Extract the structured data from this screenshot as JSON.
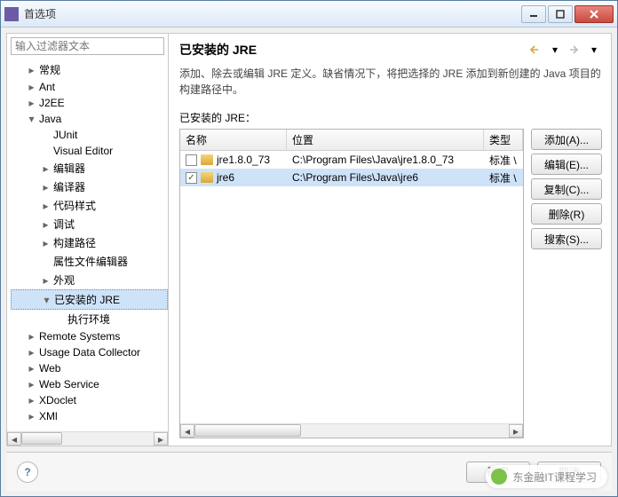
{
  "window": {
    "title": "首选项"
  },
  "filter": {
    "placeholder": "输入过滤器文本"
  },
  "tree": {
    "items": [
      {
        "label": "常规",
        "depth": 1,
        "exp": true
      },
      {
        "label": "Ant",
        "depth": 1,
        "exp": true
      },
      {
        "label": "J2EE",
        "depth": 1,
        "exp": true
      },
      {
        "label": "Java",
        "depth": 1,
        "exp": true,
        "open": true
      },
      {
        "label": "JUnit",
        "depth": 2
      },
      {
        "label": "Visual Editor",
        "depth": 2
      },
      {
        "label": "编辑器",
        "depth": 2,
        "exp": true
      },
      {
        "label": "编译器",
        "depth": 2,
        "exp": true
      },
      {
        "label": "代码样式",
        "depth": 2,
        "exp": true
      },
      {
        "label": "调试",
        "depth": 2,
        "exp": true
      },
      {
        "label": "构建路径",
        "depth": 2,
        "exp": true
      },
      {
        "label": "属性文件编辑器",
        "depth": 2
      },
      {
        "label": "外观",
        "depth": 2,
        "exp": true
      },
      {
        "label": "已安装的 JRE",
        "depth": 2,
        "exp": true,
        "open": true,
        "sel": true
      },
      {
        "label": "执行环境",
        "depth": 3
      },
      {
        "label": "Remote Systems",
        "depth": 1,
        "exp": true
      },
      {
        "label": "Usage Data Collector",
        "depth": 1,
        "exp": true
      },
      {
        "label": "Web",
        "depth": 1,
        "exp": true
      },
      {
        "label": "Web Service",
        "depth": 1,
        "exp": true
      },
      {
        "label": "XDoclet",
        "depth": 1,
        "exp": true
      },
      {
        "label": "XMl",
        "depth": 1,
        "exp": true
      }
    ]
  },
  "page": {
    "title": "已安装的 JRE",
    "desc": "添加、除去或编辑 JRE 定义。缺省情况下，将把选择的 JRE 添加到新创建的 Java 项目的构建路径中。",
    "list_label": "已安装的 JRE：",
    "columns": {
      "name": "名称",
      "location": "位置",
      "type": "类型"
    },
    "rows": [
      {
        "checked": false,
        "name": "jre1.8.0_73",
        "location": "C:\\Program Files\\Java\\jre1.8.0_73",
        "type": "标准 \\"
      },
      {
        "checked": true,
        "name": "jre6",
        "location": "C:\\Program Files\\Java\\jre6",
        "type": "标准 \\",
        "sel": true
      }
    ],
    "buttons": {
      "add": "添加(A)...",
      "edit": "编辑(E)...",
      "copy": "复制(C)...",
      "remove": "删除(R)",
      "search": "搜索(S)..."
    }
  },
  "footer": {
    "ok": "确定",
    "cancel": "取消",
    "help": "?"
  },
  "watermark": "东金融IT课程学习"
}
